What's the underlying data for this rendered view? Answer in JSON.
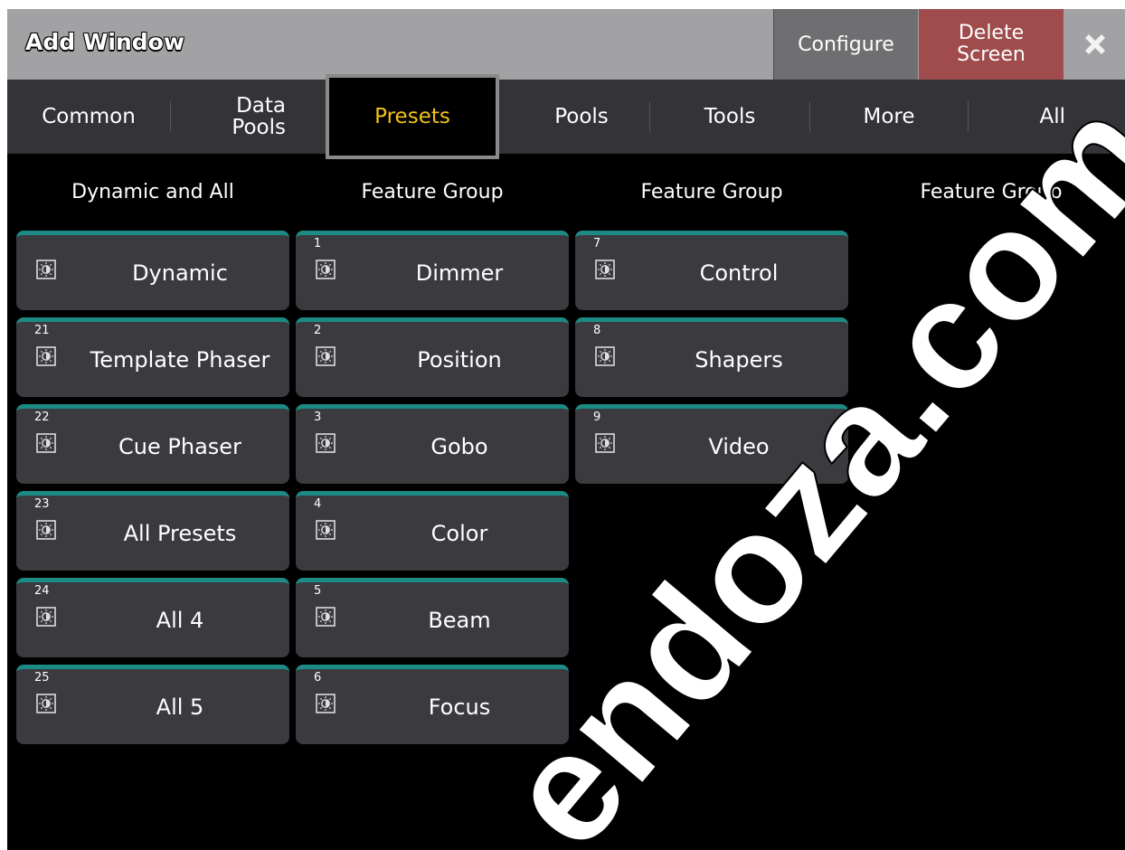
{
  "window": {
    "title": "Add Window"
  },
  "titlebar": {
    "configure_label": "Configure",
    "delete_label": "Delete Screen",
    "close_icon": "close-x-icon"
  },
  "tabs": [
    {
      "label": "Common"
    },
    {
      "label": "Data Pools"
    },
    {
      "label": "Presets",
      "active": true
    },
    {
      "label": "Pools"
    },
    {
      "label": "Tools"
    },
    {
      "label": "More"
    },
    {
      "label": "All"
    }
  ],
  "columns": [
    {
      "header": "Dynamic and All",
      "items": [
        {
          "num": "",
          "label": "Dynamic"
        },
        {
          "num": "21",
          "label": "Template Phaser"
        },
        {
          "num": "22",
          "label": "Cue Phaser"
        },
        {
          "num": "23",
          "label": "All Presets"
        },
        {
          "num": "24",
          "label": "All 4"
        },
        {
          "num": "25",
          "label": "All 5"
        }
      ]
    },
    {
      "header": "Feature Group",
      "items": [
        {
          "num": "1",
          "label": "Dimmer"
        },
        {
          "num": "2",
          "label": "Position"
        },
        {
          "num": "3",
          "label": "Gobo"
        },
        {
          "num": "4",
          "label": "Color"
        },
        {
          "num": "5",
          "label": "Beam"
        },
        {
          "num": "6",
          "label": "Focus"
        }
      ]
    },
    {
      "header": "Feature Group",
      "items": [
        {
          "num": "7",
          "label": "Control"
        },
        {
          "num": "8",
          "label": "Shapers"
        },
        {
          "num": "9",
          "label": "Video"
        }
      ]
    },
    {
      "header": "Feature Group",
      "items": []
    }
  ],
  "preset_icon": "preset-sun-icon",
  "watermark": "endoza.com",
  "colors": {
    "accent": "#1c8a85",
    "active_tab_text": "#f0c21a",
    "delete": "#a04c4c"
  }
}
